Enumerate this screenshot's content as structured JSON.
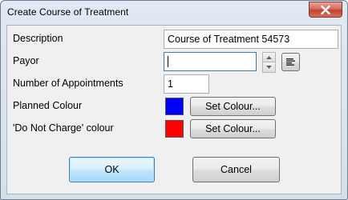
{
  "window": {
    "title": "Create Course of Treatment"
  },
  "form": {
    "description_label": "Description",
    "description_value": "Course of Treatment 54573",
    "payor_label": "Payor",
    "payor_value": "",
    "appointments_label": "Number of Appointments",
    "appointments_value": "1",
    "planned_colour_label": "Planned Colour",
    "planned_colour": "#0000ff",
    "planned_set_label": "Set Colour...",
    "dnc_colour_label": "'Do Not Charge' colour",
    "dnc_colour": "#ff0000",
    "dnc_set_label": "Set Colour..."
  },
  "buttons": {
    "ok_label": "OK",
    "cancel_label": "Cancel"
  },
  "icons": {
    "close": "close-icon",
    "spin_up": "chevron-up-icon",
    "spin_down": "chevron-down-icon",
    "lookup": "list-icon"
  }
}
